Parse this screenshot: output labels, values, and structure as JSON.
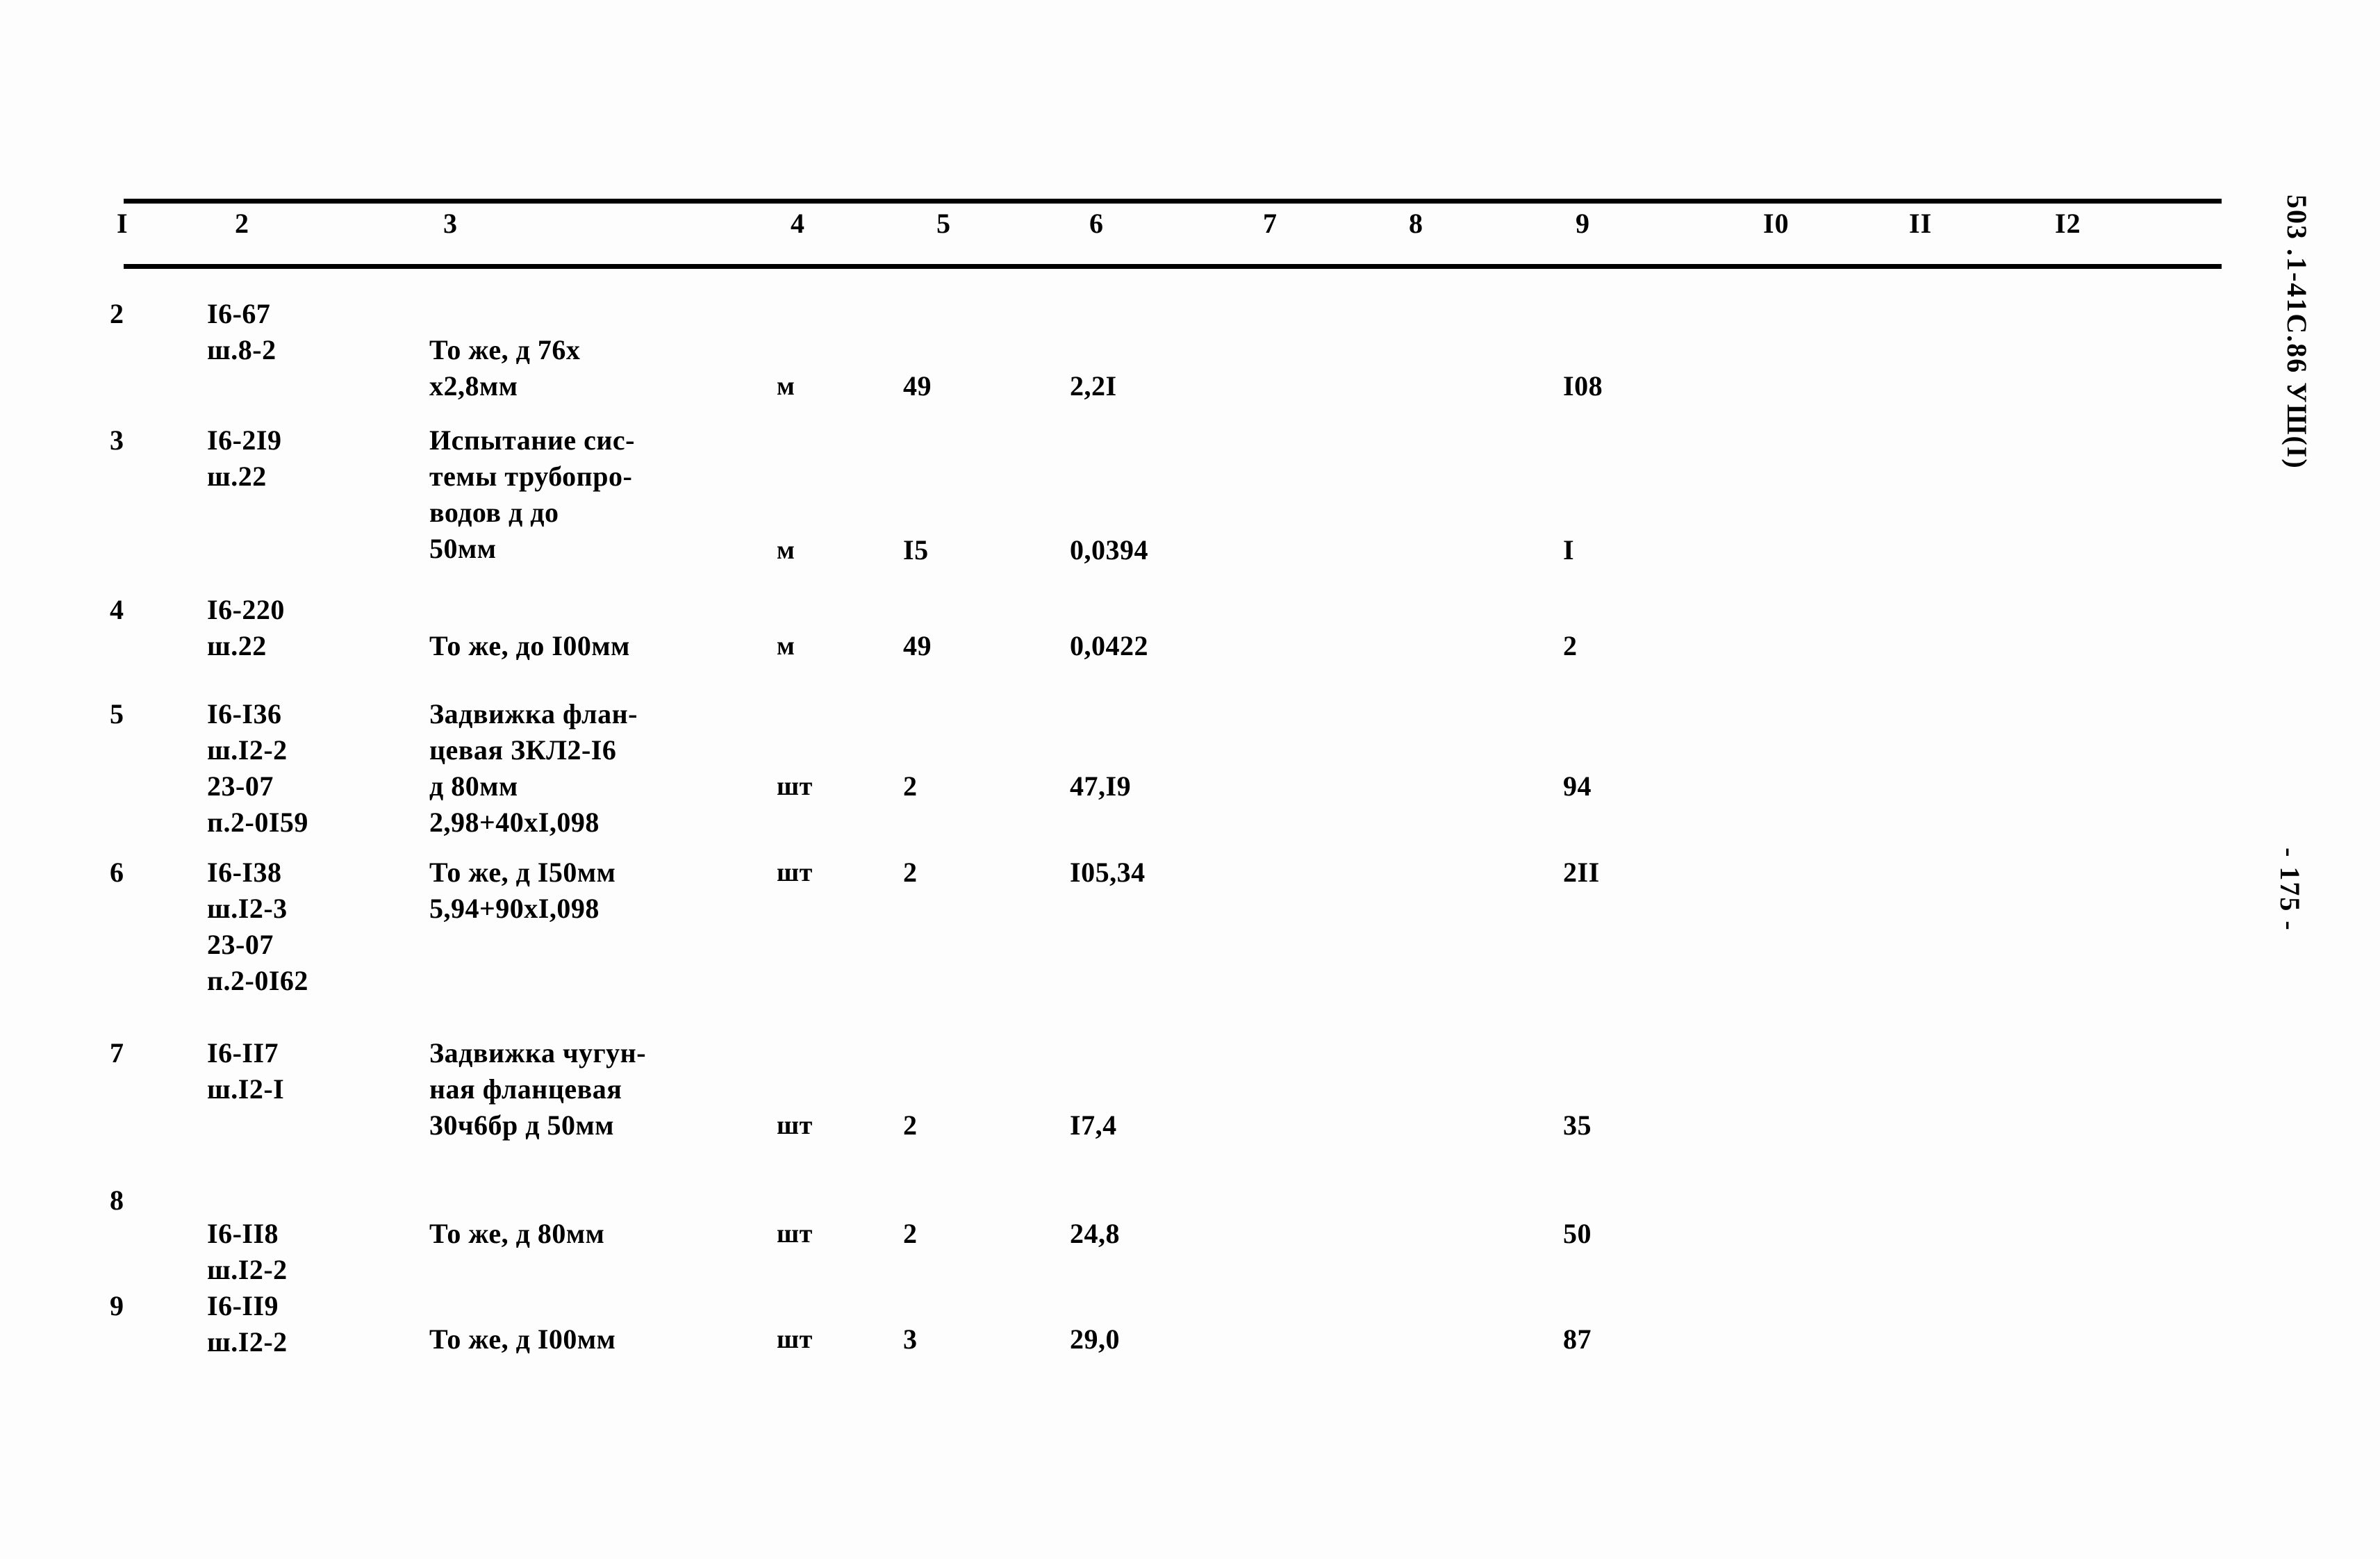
{
  "document": {
    "doc_code": "503 .1-41С.86  УШ(I)",
    "page_number": "- 175 -"
  },
  "table": {
    "column_headers": [
      "I",
      "2",
      "3",
      "4",
      "5",
      "6",
      "7",
      "8",
      "9",
      "I0",
      "II",
      "I2"
    ],
    "rows": [
      {
        "c1": "2",
        "c2": "I6-67\nш.8-2",
        "c3": "То же, д 76х\nх2,8мм",
        "c4": "м",
        "c5": "49",
        "c6": "2,2I",
        "c7": "",
        "c8": "",
        "c9": "I08",
        "c10": "",
        "c11": "",
        "c12": ""
      },
      {
        "c1": "3",
        "c2": "I6-2I9\nш.22",
        "c3": "Испытание сис-\nтемы трубопро-\nводов д до\n50мм",
        "c4": "м",
        "c5": "I5",
        "c6": "0,0394",
        "c7": "",
        "c8": "",
        "c9": "I",
        "c10": "",
        "c11": "",
        "c12": ""
      },
      {
        "c1": "4",
        "c2": "I6-220\nш.22",
        "c3": "То же, до I00мм",
        "c4": "м",
        "c5": "49",
        "c6": "0,0422",
        "c7": "",
        "c8": "",
        "c9": "2",
        "c10": "",
        "c11": "",
        "c12": ""
      },
      {
        "c1": "5",
        "c2": "I6-I36\nш.I2-2\n23-07\nп.2-0I59",
        "c3": "Задвижка флан-\nцевая ЗКЛ2-I6\nд 80мм\n2,98+40хI,098",
        "c4": "шт",
        "c5": "2",
        "c6": "47,I9",
        "c7": "",
        "c8": "",
        "c9": "94",
        "c10": "",
        "c11": "",
        "c12": ""
      },
      {
        "c1": "6",
        "c2": "I6-I38\nш.I2-3\n23-07\nп.2-0I62",
        "c3": "То же, д I50мм\n5,94+90хI,098",
        "c4": "шт",
        "c5": "2",
        "c6": "I05,34",
        "c7": "",
        "c8": "",
        "c9": "2II",
        "c10": "",
        "c11": "",
        "c12": ""
      },
      {
        "c1": "7",
        "c2": "I6-II7\nш.I2-I",
        "c3": "Задвижка чугун-\nная фланцевая\n30ч6бр д 50мм",
        "c4": "шт",
        "c5": "2",
        "c6": "I7,4",
        "c7": "",
        "c8": "",
        "c9": "35",
        "c10": "",
        "c11": "",
        "c12": ""
      },
      {
        "c1": "8",
        "c2": "I6-II8\nш.I2-2",
        "c3": "То же, д 80мм",
        "c4": "шт",
        "c5": "2",
        "c6": "24,8",
        "c7": "",
        "c8": "",
        "c9": "50",
        "c10": "",
        "c11": "",
        "c12": ""
      },
      {
        "c1": "9",
        "c2": "I6-II9\nш.I2-2",
        "c3": "То же, д I00мм",
        "c4": "шт",
        "c5": "3",
        "c6": "29,0",
        "c7": "",
        "c8": "",
        "c9": "87",
        "c10": "",
        "c11": "",
        "c12": ""
      }
    ]
  }
}
